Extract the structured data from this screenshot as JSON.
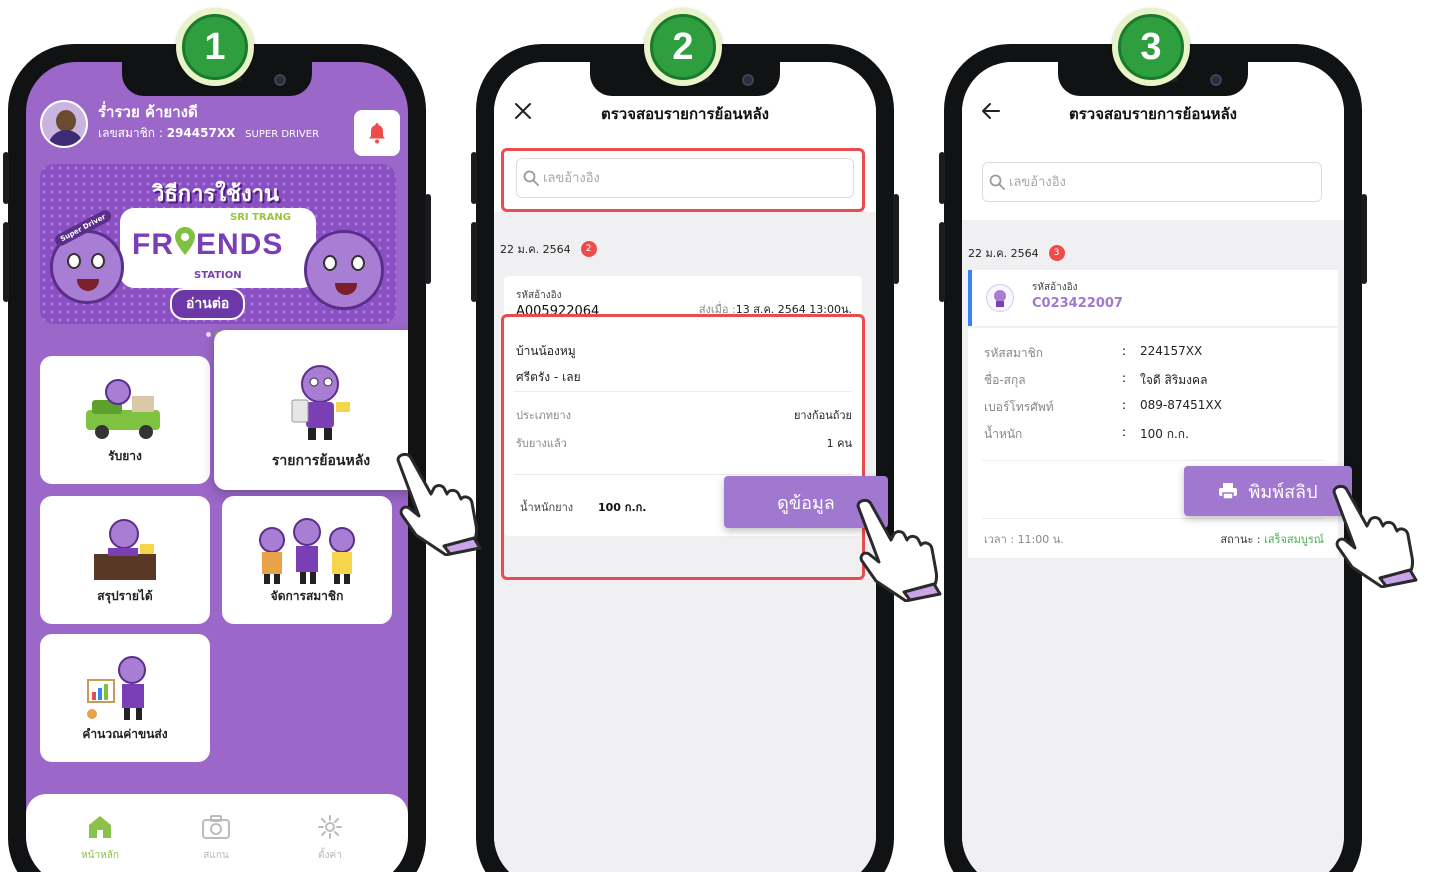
{
  "steps": [
    "1",
    "2",
    "3"
  ],
  "phone1": {
    "user_name": "ร่ำรวย  ค้ายางดี",
    "member_label": "เลขสมาชิก :",
    "member_id": "294457XX",
    "member_tier": "SUPER DRIVER",
    "banner": {
      "title": "วิธีการใช้งาน",
      "subtitle": "SRI TRANG",
      "brand_left": "FR",
      "brand_right": "ENDS",
      "station": "STATION",
      "badge": "Super Driver",
      "read_more": "อ่านต่อ"
    },
    "tiles": [
      {
        "label": "รับยาง"
      },
      {
        "label": "รายการย้อนหลัง"
      },
      {
        "label": "สรุปรายได้"
      },
      {
        "label": "จัดการสมาชิก"
      },
      {
        "label": "คำนวณค่าขนส่ง"
      }
    ],
    "tabs": [
      {
        "label": "หน้าหลัก"
      },
      {
        "label": "สแกน"
      },
      {
        "label": "ตั้งค่า"
      }
    ],
    "colors": {
      "purple": "#9b67c9",
      "green": "#8bc34a",
      "bell": "#f04b4b"
    }
  },
  "phone2": {
    "title": "ตรวจสอบรายการย้อนหลัง",
    "search_placeholder": "เลขอ้างอิง",
    "date": "22 ม.ค. 2564",
    "count": "2",
    "card": {
      "ref_label": "รหัสอ้างอิง",
      "ref_value": "A005922064",
      "sent_label": "ส่งเมื่อ :",
      "sent_value": "13 ส.ค. 2564 13:00น.",
      "place": "บ้านน้องหมู",
      "area": "ศรีตรัง - เลย",
      "type_label": "ประเภทยาง",
      "type_value": "ยางก้อนถ้วย",
      "received_label": "รับยางแล้ว",
      "received_value": "1 คน",
      "weight_label": "น้ำหนักยาง",
      "weight_value": "100 ก.ก.",
      "view_button": "ดูข้อมูล"
    }
  },
  "phone3": {
    "title": "ตรวจสอบรายการย้อนหลัง",
    "search_placeholder": "เลขอ้างอิง",
    "date": "22 ม.ค. 2564",
    "count": "3",
    "ref_label": "รหัสอ้างอิง",
    "ref_value": "C023422007",
    "details": [
      {
        "label": "รหัสสมาชิก",
        "value": "224157XX"
      },
      {
        "label": "ชื่อ-สกุล",
        "value": "ใจดี สิริมงคล"
      },
      {
        "label": "เบอร์โทรศัพท์",
        "value": "089-87451XX"
      },
      {
        "label": "น้ำหนัก",
        "value": "100 ก.ก."
      }
    ],
    "colon": ":",
    "print_button": "พิมพ์สลิป",
    "time_label": "เวลา :",
    "time_value": "11:00 น.",
    "status_label": "สถานะ :",
    "status_value": "เสร็จสมบูรณ์",
    "colors": {
      "accent": "#a178d0",
      "status": "#4caf50",
      "bar": "#3b82f6"
    }
  }
}
